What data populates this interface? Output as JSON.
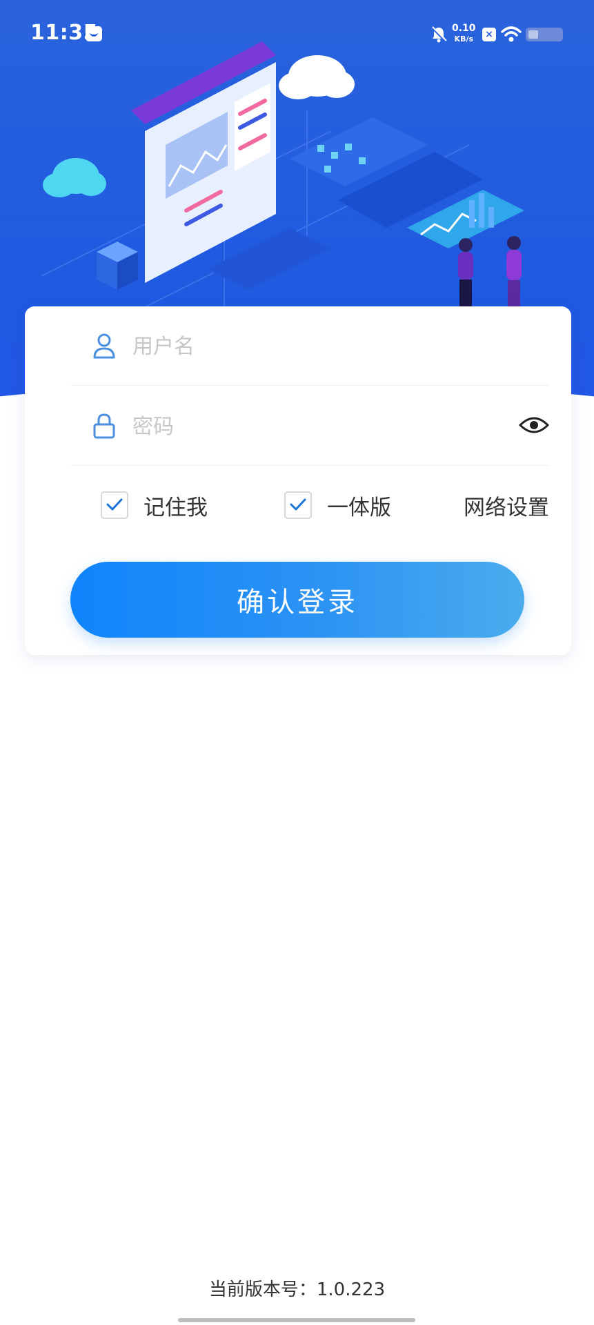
{
  "status_bar": {
    "time": "11:35",
    "net_speed_value": "0.10",
    "net_speed_unit": "KB/s"
  },
  "login_form": {
    "username_placeholder": "用户名",
    "password_placeholder": "密码",
    "remember_me_label": "记住我",
    "remember_me_checked": true,
    "all_in_one_label": "一体版",
    "all_in_one_checked": true,
    "network_settings_label": "网络设置",
    "submit_label": "确认登录"
  },
  "footer": {
    "version_text": "当前版本号：1.0.223"
  },
  "colors": {
    "hero_blue": "#2a63dc",
    "button_start": "#0f84fb",
    "button_end": "#4aaced",
    "check_blue": "#1a73d9"
  },
  "icons": [
    "mail-icon",
    "bell-off-icon",
    "close-icon",
    "wifi-icon",
    "battery-icon",
    "user-icon",
    "lock-icon",
    "eye-icon",
    "check-icon"
  ]
}
